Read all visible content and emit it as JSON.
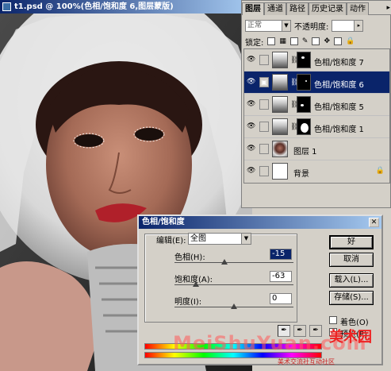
{
  "document": {
    "title": "t1.psd @ 100%(色相/饱和度 6,图层蒙版)"
  },
  "layers_panel": {
    "tabs": [
      "图层",
      "通道",
      "路径",
      "历史记录",
      "动作"
    ],
    "blend_mode": "正常",
    "opacity_label": "不透明度:",
    "lock_label": "锁定:",
    "layers": [
      {
        "name": "色相/饱和度 7",
        "type": "adjustment",
        "selected": false
      },
      {
        "name": "色相/饱和度 6",
        "type": "adjustment",
        "selected": true
      },
      {
        "name": "色相/饱和度 5",
        "type": "adjustment",
        "selected": false
      },
      {
        "name": "色相/饱和度 1",
        "type": "adjustment",
        "selected": false
      },
      {
        "name": "图层 1",
        "type": "pixel",
        "selected": false
      },
      {
        "name": "背景",
        "type": "background",
        "selected": false
      }
    ]
  },
  "dialog": {
    "title": "色相/饱和度",
    "edit_label": "编辑(E):",
    "edit_value": "全图",
    "hue_label": "色相(H):",
    "hue_value": "-15",
    "saturation_label": "饱和度(A):",
    "saturation_value": "-63",
    "lightness_label": "明度(I):",
    "lightness_value": "0",
    "ok_label": "好",
    "cancel_label": "取消",
    "load_label": "载入(L)...",
    "save_label": "存储(S)...",
    "colorize_label": "着色(O)",
    "preview_label": "预览(P)"
  },
  "watermark": {
    "latin": "MeiShuYuan.com",
    "cn": "美术园",
    "cn_sub": "美术交流社互动社区"
  },
  "colors": {
    "titlebar_start": "#0a246a",
    "titlebar_end": "#a6caf0",
    "selected_layer": "#0a246a"
  }
}
